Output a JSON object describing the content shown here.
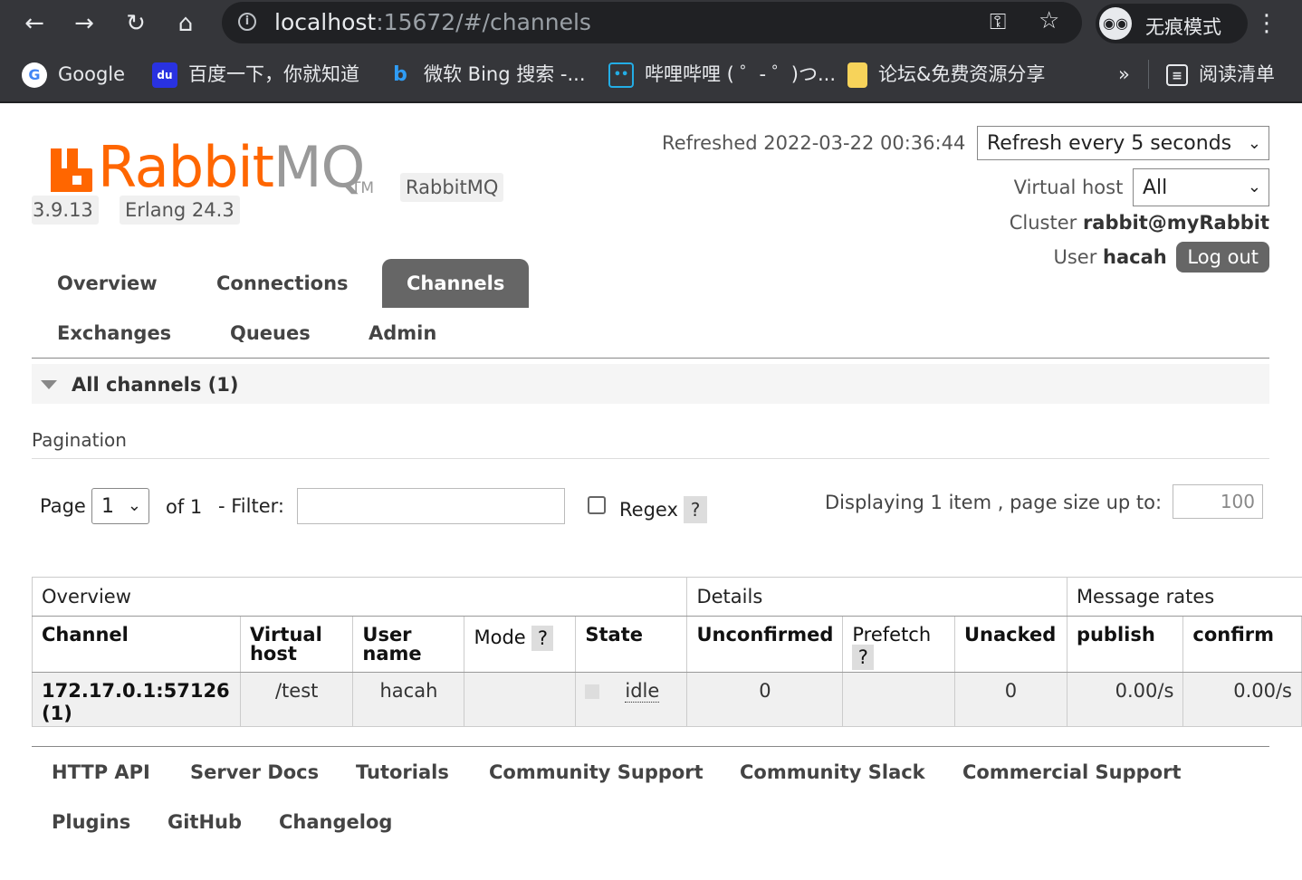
{
  "browser": {
    "url_host": "localhost",
    "url_rest": ":15672/#/channels",
    "incognito_label": "无痕模式",
    "bookmarks": [
      {
        "label": "Google",
        "icon": "google-icon"
      },
      {
        "label": "百度一下，你就知道",
        "icon": "baidu-icon"
      },
      {
        "label": "微软 Bing 搜索 -...",
        "icon": "bing-icon"
      },
      {
        "label": "哔哩哔哩 ( ゜- ゜)つ...",
        "icon": "bilibili-icon"
      },
      {
        "label": "论坛&免费资源分享",
        "icon": "folder-icon"
      }
    ],
    "more_label": "»",
    "reading_list_label": "阅读清单"
  },
  "header": {
    "logo_rabbit": "Rabbit",
    "logo_mq": "MQ",
    "logo_tm": "TM",
    "product_tag": "RabbitMQ",
    "version": "3.9.13",
    "erlang": "Erlang 24.3",
    "refreshed_label": "Refreshed 2022-03-22 00:36:44",
    "refresh_select": "Refresh every 5 seconds",
    "vhost_label": "Virtual host",
    "vhost_select": "All",
    "cluster_label": "Cluster",
    "cluster_name": "rabbit@myRabbit",
    "user_label": "User",
    "user_name": "hacah",
    "logout_label": "Log out"
  },
  "tabs": {
    "overview": "Overview",
    "connections": "Connections",
    "channels": "Channels",
    "exchanges": "Exchanges",
    "queues": "Queues",
    "admin": "Admin"
  },
  "section": {
    "title": "All channels (1)",
    "pagination_title": "Pagination",
    "page_label": "Page",
    "page_value": "1",
    "of_label": "of 1",
    "filter_label": "- Filter:",
    "filter_value": "",
    "regex_label": "Regex",
    "help": "?",
    "displaying_label": "Displaying 1 item , page size up to:",
    "page_size": "100"
  },
  "table": {
    "groups": {
      "overview": "Overview",
      "details": "Details",
      "rates": "Message rates"
    },
    "columns": {
      "channel": "Channel",
      "vhost_1": "Virtual",
      "vhost_2": "host",
      "user_1": "User",
      "user_2": "name",
      "mode": "Mode",
      "state": "State",
      "unconfirmed": "Unconfirmed",
      "prefetch": "Prefetch",
      "unacked": "Unacked",
      "publish": "publish",
      "confirm": "confirm"
    },
    "row": {
      "channel_1": "172.17.0.1:57126",
      "channel_2": "(1)",
      "vhost": "/test",
      "user": "hacah",
      "mode": "",
      "state": "idle",
      "unconfirmed": "0",
      "prefetch": "",
      "unacked": "0",
      "publish": "0.00/s",
      "confirm": "0.00/s"
    }
  },
  "footer": {
    "http_api": "HTTP API",
    "server_docs": "Server Docs",
    "tutorials": "Tutorials",
    "community_support": "Community Support",
    "community_slack": "Community Slack",
    "commercial_support": "Commercial Support",
    "plugins": "Plugins",
    "github": "GitHub",
    "changelog": "Changelog"
  }
}
